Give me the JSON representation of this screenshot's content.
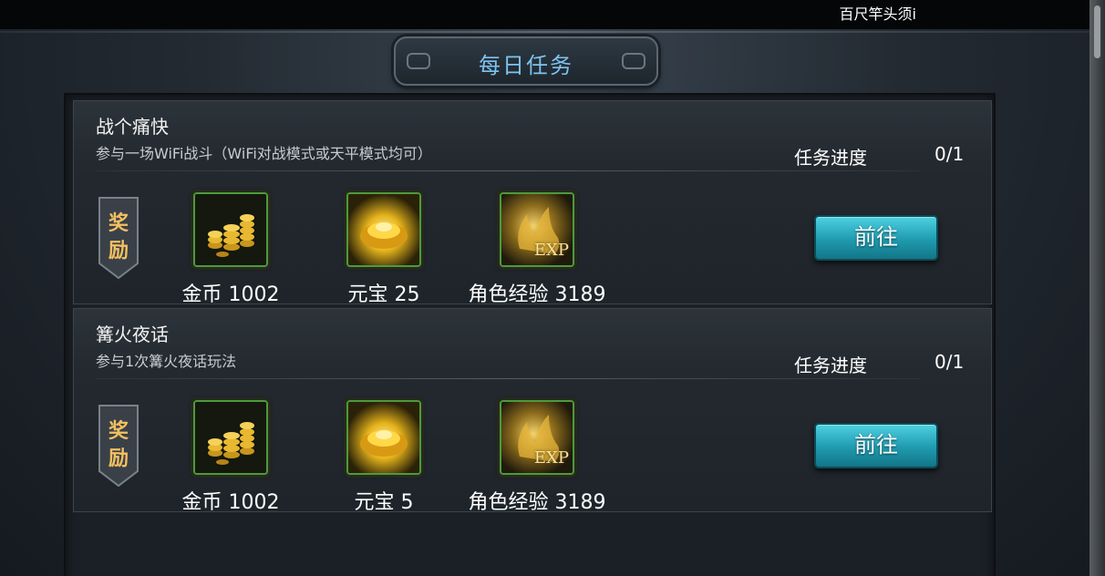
{
  "top_hint": "百尺竿头须i",
  "title": "每日任务",
  "colors": {
    "title_text": "#7ec3f0",
    "button": "#1f9aae",
    "reward_tag_text": "#f4c060",
    "icon_border": "#4e9a3b"
  },
  "tasks": [
    {
      "name": "战个痛快",
      "description": "参与一场WiFi战斗（WiFi对战模式或天平模式均可）",
      "progress_label": "任务进度",
      "progress_value": "0/1",
      "reward_tag_line1": "奖",
      "reward_tag_line2": "励",
      "rewards": [
        {
          "icon": "gold-coins-icon",
          "label": "金币 1002"
        },
        {
          "icon": "gold-ingot-icon",
          "label": "元宝 25"
        },
        {
          "icon": "exp-icon",
          "label": "角色经验 3189",
          "icon_text": "EXP"
        }
      ],
      "button_label": "前往"
    },
    {
      "name": "篝火夜话",
      "description": "参与1次篝火夜话玩法",
      "progress_label": "任务进度",
      "progress_value": "0/1",
      "reward_tag_line1": "奖",
      "reward_tag_line2": "励",
      "rewards": [
        {
          "icon": "gold-coins-icon",
          "label": "金币 1002"
        },
        {
          "icon": "gold-ingot-icon",
          "label": "元宝 5"
        },
        {
          "icon": "exp-icon",
          "label": "角色经验 3189",
          "icon_text": "EXP"
        }
      ],
      "button_label": "前往"
    }
  ]
}
